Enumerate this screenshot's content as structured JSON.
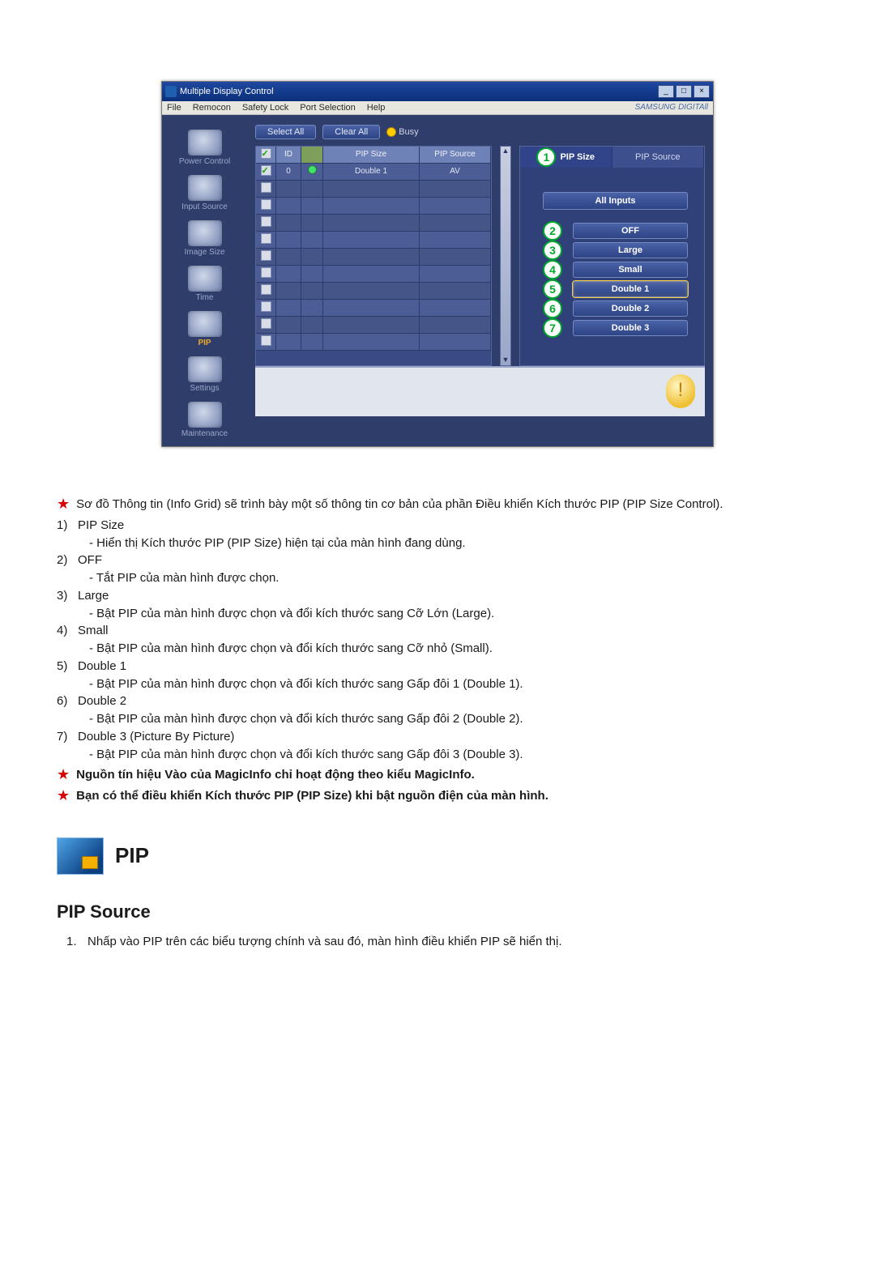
{
  "window": {
    "title": "Multiple Display Control",
    "menu": {
      "file": "File",
      "remocon": "Remocon",
      "safety": "Safety Lock",
      "port": "Port Selection",
      "help": "Help"
    },
    "brand": "SAMSUNG DIGITAll"
  },
  "sidebar": {
    "items": [
      {
        "label": "Power Control"
      },
      {
        "label": "Input Source"
      },
      {
        "label": "Image Size"
      },
      {
        "label": "Time"
      },
      {
        "label": "PIP"
      },
      {
        "label": "Settings"
      },
      {
        "label": "Maintenance"
      }
    ]
  },
  "toolbar": {
    "select_all": "Select All",
    "clear_all": "Clear All",
    "busy": "Busy"
  },
  "grid": {
    "headers": {
      "id": "ID",
      "status": "",
      "size": "PIP Size",
      "source": "PIP Source"
    },
    "rows": [
      {
        "checked": true,
        "id": "0",
        "status": "on",
        "size": "Double 1",
        "source": "AV"
      },
      {
        "checked": false,
        "id": "",
        "status": "",
        "size": "",
        "source": ""
      },
      {
        "checked": false,
        "id": "",
        "status": "",
        "size": "",
        "source": ""
      },
      {
        "checked": false,
        "id": "",
        "status": "",
        "size": "",
        "source": ""
      },
      {
        "checked": false,
        "id": "",
        "status": "",
        "size": "",
        "source": ""
      },
      {
        "checked": false,
        "id": "",
        "status": "",
        "size": "",
        "source": ""
      },
      {
        "checked": false,
        "id": "",
        "status": "",
        "size": "",
        "source": ""
      },
      {
        "checked": false,
        "id": "",
        "status": "",
        "size": "",
        "source": ""
      },
      {
        "checked": false,
        "id": "",
        "status": "",
        "size": "",
        "source": ""
      },
      {
        "checked": false,
        "id": "",
        "status": "",
        "size": "",
        "source": ""
      },
      {
        "checked": false,
        "id": "",
        "status": "",
        "size": "",
        "source": ""
      }
    ]
  },
  "panel": {
    "tabs": {
      "size": "PIP Size",
      "source": "PIP Source"
    },
    "all_inputs": "All Inputs",
    "options": [
      {
        "n": "2",
        "label": "OFF"
      },
      {
        "n": "3",
        "label": "Large"
      },
      {
        "n": "4",
        "label": "Small"
      },
      {
        "n": "5",
        "label": "Double 1"
      },
      {
        "n": "6",
        "label": "Double 2"
      },
      {
        "n": "7",
        "label": "Double 3"
      }
    ],
    "callout_tab": "1"
  },
  "doc": {
    "intro": "Sơ đồ Thông tin (Info Grid) sẽ trình bày một số thông tin cơ bản của phần Điều khiển Kích thước PIP (PIP Size Control).",
    "items": [
      {
        "n": "1)",
        "title": "PIP Size",
        "desc": "-  Hiển thị Kích thước PIP (PIP Size) hiện tại của màn hình đang dùng."
      },
      {
        "n": "2)",
        "title": "OFF",
        "desc": "-  Tắt PIP của màn hình được chọn."
      },
      {
        "n": "3)",
        "title": "Large",
        "desc": "-  Bật PIP của màn hình được chọn và đổi kích thước sang Cỡ Lớn (Large)."
      },
      {
        "n": "4)",
        "title": "Small",
        "desc": "-  Bật PIP của màn hình được chọn và đổi kích thước sang Cỡ nhỏ (Small)."
      },
      {
        "n": "5)",
        "title": "Double 1",
        "desc": "- Bật PIP của màn hình được chọn và đổi kích thước sang Gấp đôi 1 (Double 1)."
      },
      {
        "n": "6)",
        "title": "Double 2",
        "desc": "- Bật PIP của màn hình được chọn và đổi kích thước sang Gấp đôi 2 (Double 2)."
      },
      {
        "n": "7)",
        "title": "Double 3 (Picture By Picture)",
        "desc": "- Bật PIP của màn hình được chọn và đổi kích thước sang Gấp đôi 3 (Double 3)."
      }
    ],
    "note1": "Nguồn tín hiệu Vào của MagicInfo chỉ hoạt động theo kiểu MagicInfo.",
    "note2": "Bạn có thể điều khiển Kích thước PIP (PIP Size) khi bật nguồn điện của màn hình.",
    "pip_heading": "PIP",
    "section_title": "PIP Source",
    "section_line": "Nhấp vào PIP trên các biểu tượng chính và sau đó, màn hình điều khiển PIP sẽ hiển thị.",
    "section_num": "1."
  }
}
